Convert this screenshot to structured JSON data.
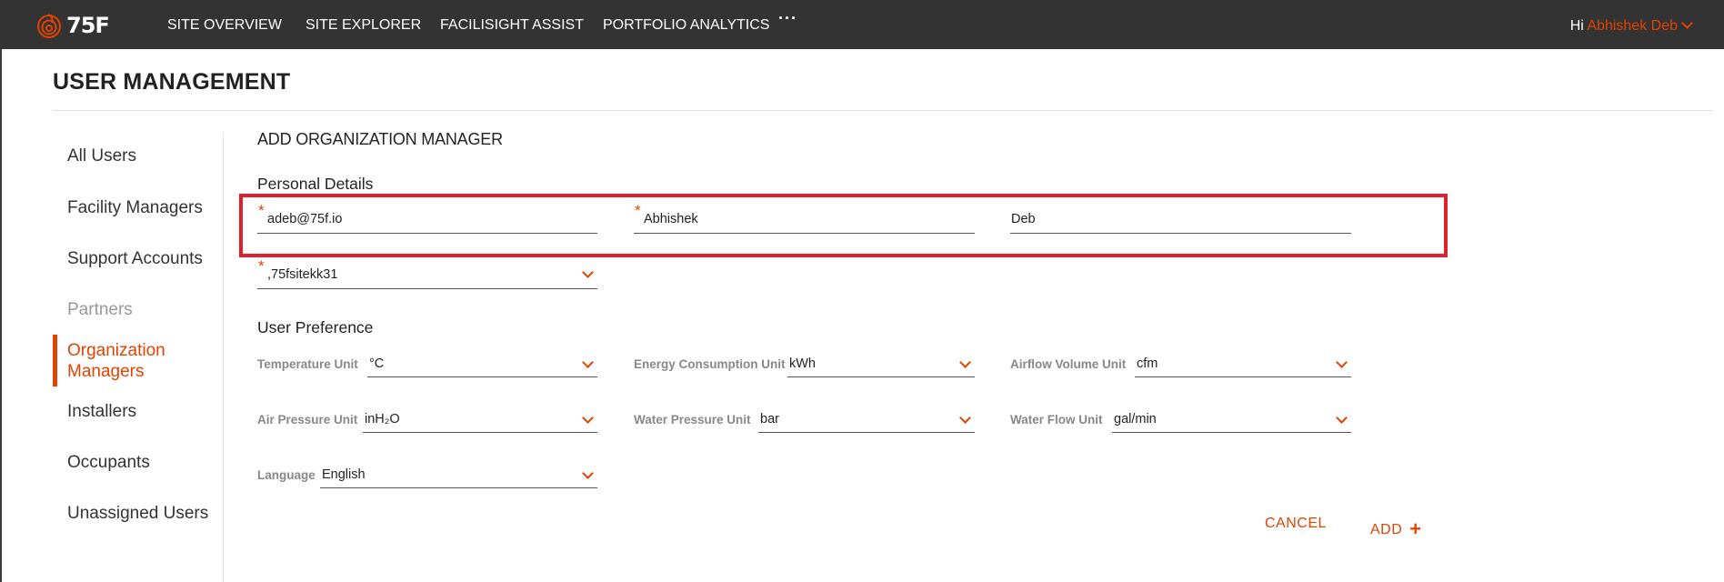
{
  "nav": {
    "brand": "75F",
    "items": [
      "SITE OVERVIEW",
      "SITE EXPLORER",
      "FACILISIGHT ASSIST",
      "PORTFOLIO ANALYTICS"
    ],
    "more": "···",
    "greeting": "Hi",
    "user_name": "Abhishek Deb"
  },
  "page": {
    "title": "USER MANAGEMENT"
  },
  "sidebar": {
    "items": [
      {
        "label": "All Users"
      },
      {
        "label": "Facility Managers"
      },
      {
        "label": "Support Accounts"
      },
      {
        "label": "Partners"
      },
      {
        "label": "Organization Managers",
        "line1": "Organization",
        "line2": "Managers"
      },
      {
        "label": "Installers"
      },
      {
        "label": "Occupants"
      },
      {
        "label": "Unassigned Users"
      }
    ]
  },
  "form": {
    "title": "ADD ORGANIZATION MANAGER",
    "personal_details": {
      "heading": "Personal Details",
      "required_marker": "*",
      "email": "adeb@75f.io",
      "first_name": "Abhishek",
      "last_name": "Deb",
      "site": ",75fsitekk31"
    },
    "preferences": {
      "heading": "User Preference",
      "temperature_unit": {
        "label": "Temperature Unit",
        "value": "°C"
      },
      "energy_unit": {
        "label": "Energy Consumption Unit",
        "value": "kWh"
      },
      "airflow_unit": {
        "label": "Airflow Volume Unit",
        "value": "cfm"
      },
      "air_pressure_unit": {
        "label": "Air Pressure Unit",
        "value": "inH₂O"
      },
      "water_pressure_unit": {
        "label": "Water Pressure Unit",
        "value": "bar"
      },
      "water_flow_unit": {
        "label": "Water Flow Unit",
        "value": "gal/min"
      },
      "language": {
        "label": "Language",
        "value": "English"
      }
    },
    "actions": {
      "cancel": "CANCEL",
      "add": "ADD",
      "add_icon": "+"
    }
  },
  "colors": {
    "accent": "#e24301",
    "topbar": "#333333",
    "highlight": "#e0202a"
  }
}
